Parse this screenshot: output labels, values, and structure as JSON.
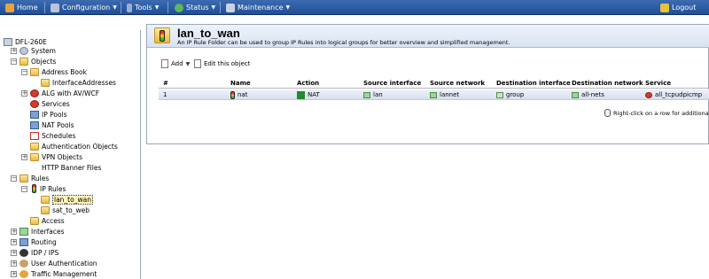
{
  "menubar": {
    "home": "Home",
    "configuration": "Configuration",
    "tools": "Tools",
    "status": "Status",
    "maintenance": "Maintenance",
    "logout": "Logout"
  },
  "tree": {
    "root": "DFL-260E",
    "system": "System",
    "objects": "Objects",
    "address_book": "Address Book",
    "interface_addresses": "InterfaceAddresses",
    "alg": "ALG with AV/WCF",
    "services": "Services",
    "ip_pools": "IP Pools",
    "nat_pools": "NAT Pools",
    "schedules": "Schedules",
    "auth_objects": "Authentication Objects",
    "vpn_objects": "VPN Objects",
    "http_banner": "HTTP Banner Files",
    "rules": "Rules",
    "ip_rules": "IP Rules",
    "lan_to_wan": "lan_to_wan",
    "sat_to_web": "sat_to_web",
    "access": "Access",
    "interfaces": "Interfaces",
    "routing": "Routing",
    "idp_ips": "IDP / IPS",
    "user_auth": "User Authentication",
    "traffic_mgmt": "Traffic Management"
  },
  "main": {
    "title": "lan_to_wan",
    "subtitle": "An IP Rule Folder can be used to group IP Rules into logical groups for better overview and simplified management.",
    "add_label": "Add",
    "edit_label": "Edit this object",
    "hint": "Right-click on a row for additional optio"
  },
  "table": {
    "headers": {
      "num": "#",
      "name": "Name",
      "action": "Action",
      "src_if": "Source interface",
      "src_net": "Source network",
      "dst_if": "Destination interface",
      "dst_net": "Destination network",
      "service": "Service"
    },
    "rows": [
      {
        "num": "1",
        "name": "nat",
        "action": "NAT",
        "src_if": "lan",
        "src_net": "lannet",
        "dst_if": "group",
        "dst_net": "all-nets",
        "service": "all_tcpudpicmp"
      }
    ]
  },
  "colors": {
    "menubar": "#2a5aa3",
    "header_bg": "#dfe7f4",
    "row_bg": "#e3e9f4",
    "nat_green": "#1f8c2a"
  }
}
